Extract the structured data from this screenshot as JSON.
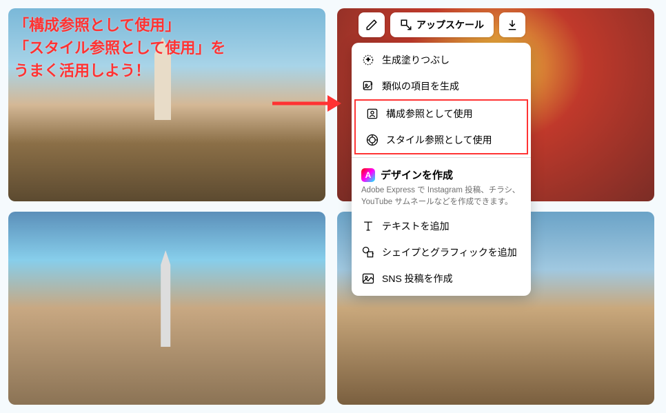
{
  "annotation": {
    "line1": "「構成参照として使用」",
    "line2": "「スタイル参照として使用」を",
    "line3": " うまく活用しよう！"
  },
  "toolbar": {
    "edit_name": "edit-icon",
    "upscale_label": "アップスケール",
    "download_name": "download-icon"
  },
  "menu": {
    "items": [
      {
        "label": "生成塗りつぶし",
        "icon": "sparkle-fill-icon"
      },
      {
        "label": "類似の項目を生成",
        "icon": "generate-similar-icon"
      }
    ],
    "highlighted": [
      {
        "label": "構成参照として使用",
        "icon": "composition-ref-icon"
      },
      {
        "label": "スタイル参照として使用",
        "icon": "style-ref-icon"
      }
    ],
    "section": {
      "title": "デザインを作成",
      "description": "Adobe Express で Instagram 投稿、チラシ、YouTube サムネールなどを作成できます。",
      "logo_letter": "A"
    },
    "bottom_items": [
      {
        "label": "テキストを追加",
        "icon": "text-icon"
      },
      {
        "label": "シェイプとグラフィックを追加",
        "icon": "shapes-icon"
      },
      {
        "label": "SNS 投稿を作成",
        "icon": "image-icon"
      }
    ]
  }
}
